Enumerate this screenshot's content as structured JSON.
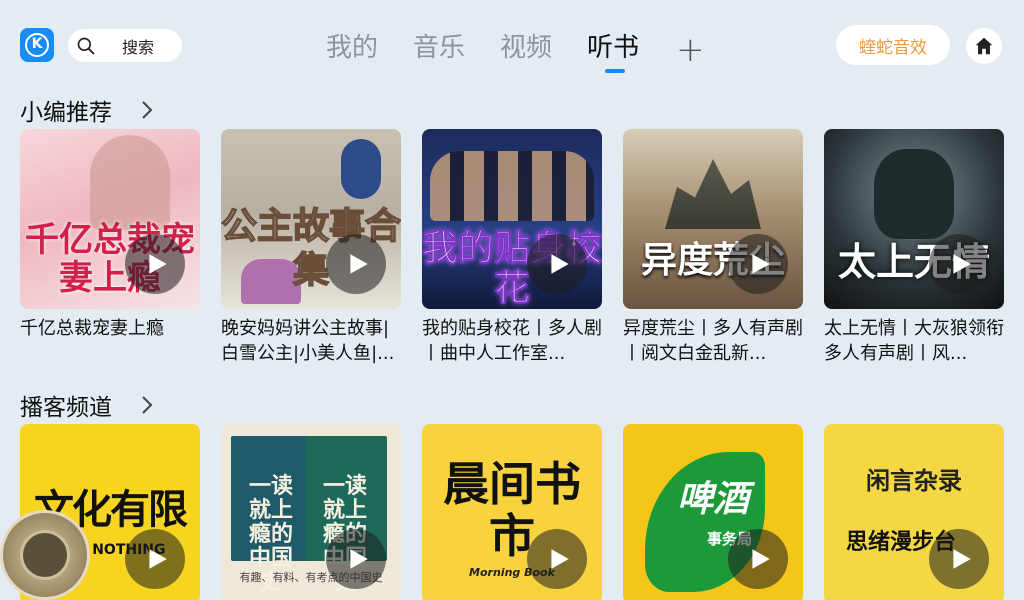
{
  "header": {
    "logo_letter": "K",
    "search_placeholder": "搜索",
    "tabs": [
      {
        "label": "我的",
        "active": false
      },
      {
        "label": "音乐",
        "active": false
      },
      {
        "label": "视频",
        "active": false
      },
      {
        "label": "听书",
        "active": true
      }
    ],
    "add_tab": "+",
    "effect_label": "蝰蛇音效",
    "accent_color": "#1a8af5",
    "effect_color": "#f09a3e"
  },
  "sections": [
    {
      "title": "小编推荐",
      "items": [
        {
          "title": "千亿总裁宠妻上瘾",
          "cover_text": "千亿总裁宠妻上瘾"
        },
        {
          "title": "晚安妈妈讲公主故事|白雪公主|小美人鱼|...",
          "cover_text": "公主故事合集"
        },
        {
          "title": "我的贴身校花丨多人剧丨曲中人工作室...",
          "cover_text": "我的贴身校花"
        },
        {
          "title": "异度荒尘丨多人有声剧丨阅文白金乱新...",
          "cover_text": "异度荒尘"
        },
        {
          "title": "太上无情丨大灰狼领衔多人有声剧丨风...",
          "cover_text": "太上无情"
        }
      ]
    },
    {
      "title": "播客频道",
      "items": [
        {
          "cover_text": "文化有限",
          "cover_sub": "OW NOTHING"
        },
        {
          "cover_text_a": "一读就上瘾的中国史",
          "cover_text_b": "一读就上瘾的中国史",
          "cover_sub": "有趣、有料、有考点的中国史"
        },
        {
          "cover_text": "晨间书市",
          "cover_sub": "Morning Book"
        },
        {
          "cover_text": "啤酒",
          "cover_sub": "事务局"
        },
        {
          "cover_text": "闲言杂录",
          "cover_sub": "思绪漫步台"
        }
      ]
    }
  ],
  "icons": [
    "search-icon",
    "chevron-right-icon",
    "play-icon",
    "home-icon"
  ]
}
